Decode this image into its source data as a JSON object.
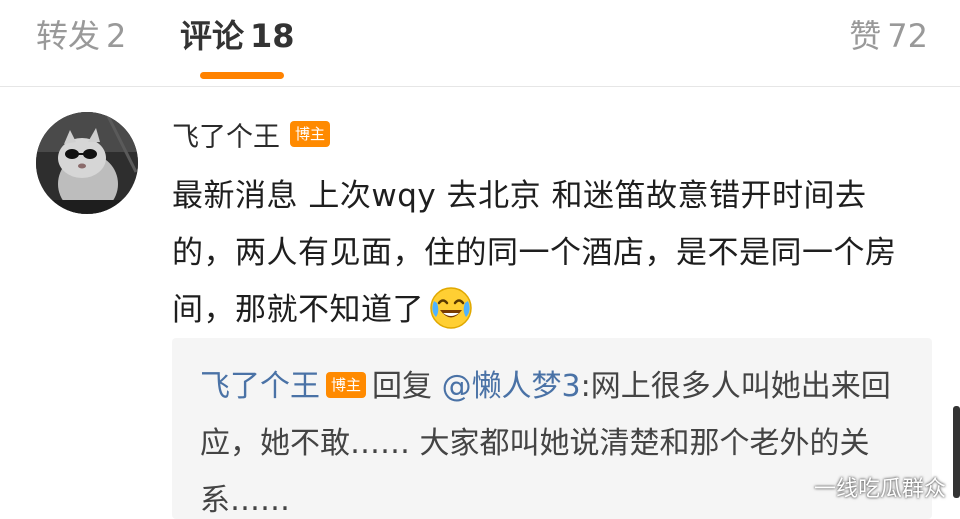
{
  "tabs": {
    "repost": {
      "label": "转发",
      "count": "2"
    },
    "comments": {
      "label": "评论",
      "count": "18"
    },
    "likes": {
      "label": "赞",
      "count": "72"
    }
  },
  "comment": {
    "username": "飞了个王",
    "badge": "博主",
    "text": "最新消息 上次wqy 去北京 和迷笛故意错开时间去的，两人有见面，住的同一个酒店，是不是同一个房间，那就不知道了",
    "emoji": "laughing-crying-emoji"
  },
  "reply": {
    "username": "飞了个王",
    "badge": "博主",
    "reply_word": "回复",
    "mention": "@懒人梦3",
    "text": ":网上很多人叫她出来回应，她不敢…… 大家都叫她说清楚和那个老外的关系……"
  },
  "watermark": "一线吃瓜群众",
  "colors": {
    "accent": "#ff8200",
    "badge": "#ff8a00",
    "link": "#4a72a6",
    "reply_bg": "#f5f5f5"
  }
}
